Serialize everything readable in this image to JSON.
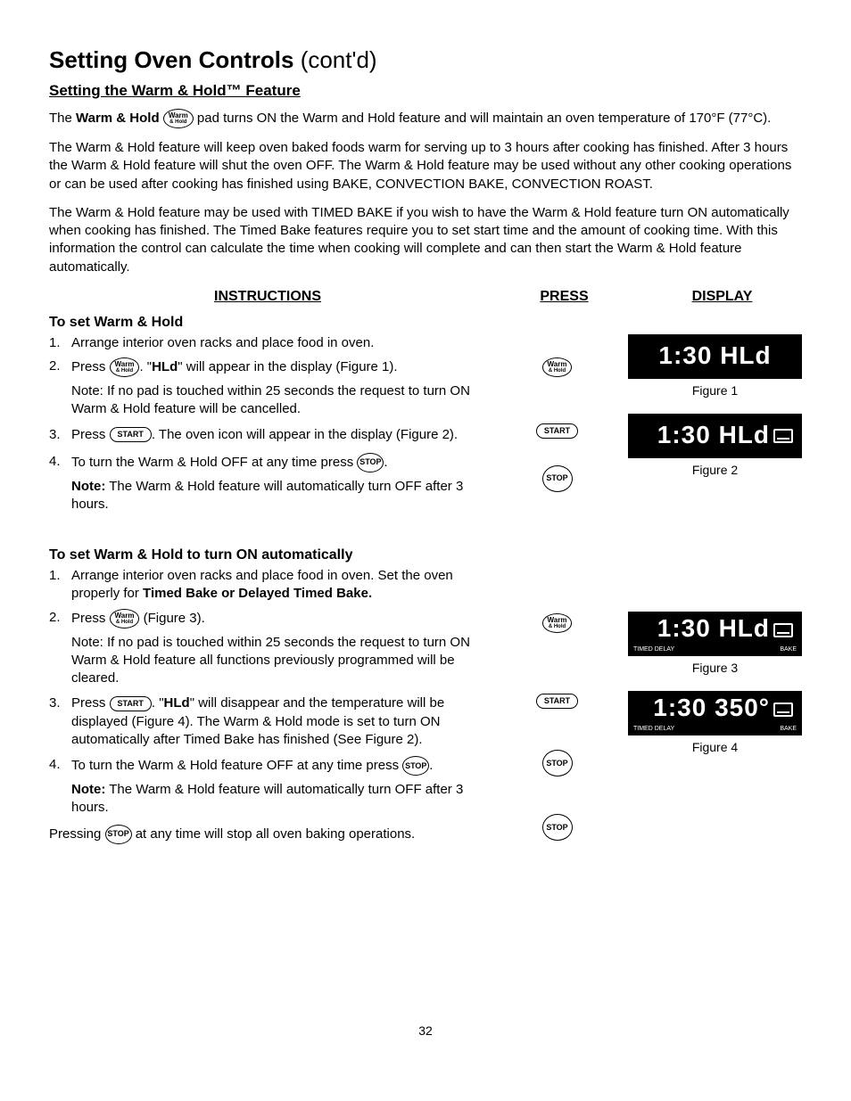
{
  "title_main": "Setting Oven Controls ",
  "title_contd": "(cont'd)",
  "subtitle": "Setting the Warm & Hold™ Feature",
  "intro1_a": "The ",
  "intro1_b": "Warm & Hold",
  "intro1_c": " pad turns ON the Warm and Hold feature and will maintain an oven temperature of 170°F (77°C).",
  "intro2": "The Warm & Hold feature will keep oven baked foods warm for serving up to 3 hours after cooking has finished. After 3 hours the Warm & Hold feature will shut the oven OFF. The Warm & Hold feature may be used without any other cooking operations or can be used after cooking has finished using BAKE, CONVECTION BAKE, CONVECTION ROAST.",
  "intro3": "The Warm & Hold feature may be used with TIMED BAKE if you wish to have the Warm & Hold feature turn ON automatically when cooking has finished. The Timed Bake features require you to set start time and the amount of cooking time. With this information the control can calculate the time when cooking will complete and can then start the Warm & Hold feature automatically.",
  "hdr_instructions": "INSTRUCTIONS",
  "hdr_press": "PRESS",
  "hdr_display": "DISPLAY",
  "sec1_title": "To set Warm & Hold",
  "s1_1": "Arrange interior oven racks and place food in oven.",
  "s1_2a": "Press ",
  "s1_2b": ". \"",
  "s1_2_hld": "HLd",
  "s1_2c": "\" will appear in the display (Figure 1).",
  "s1_2_note": "Note: If no pad is touched within 25 seconds the request to turn ON Warm & Hold feature will be cancelled.",
  "s1_3a": "Press ",
  "s1_3b": ". The oven icon will appear in the display (Figure 2).",
  "s1_4a": "To turn the Warm & Hold OFF at any time press ",
  "s1_4b": ".",
  "s1_4_note_b": "Note:",
  "s1_4_note": " The Warm & Hold feature will automatically turn OFF after 3 hours.",
  "sec2_title": "To set Warm & Hold to turn ON automatically",
  "s2_1a": "Arrange interior oven racks and place food in oven. Set the oven properly for ",
  "s2_1b": "Timed Bake or Delayed Timed Bake.",
  "s2_2a": "Press ",
  "s2_2b": " (Figure 3).",
  "s2_2_note": "Note: If no pad is touched within 25 seconds the request to turn ON Warm & Hold feature all functions previously programmed will be cleared.",
  "s2_3a": "Press ",
  "s2_3b": ". \"",
  "s2_3_hld": "HLd",
  "s2_3c": "\" will disappear and the temperature will be displayed (Figure 4). The Warm & Hold mode is set to turn ON automatically after Timed Bake has finished (See Figure 2).",
  "s2_4a": "To turn the Warm & Hold feature OFF at any time press ",
  "s2_4b": ".",
  "s2_4_note_b": "Note:",
  "s2_4_note": " The Warm & Hold feature will automatically turn OFF after 3 hours.",
  "s2_press_a": "Pressing ",
  "s2_press_b": " at any time will stop all oven baking operations.",
  "btn_warm_top": "Warm",
  "btn_warm_sub": "& Hold",
  "btn_start": "START",
  "btn_stop": "STOP",
  "disp1": "1:30 HLd",
  "disp2_main": "1:30 HLd",
  "disp3_main": "1:30 HLd",
  "disp4_main": "1:30 350°",
  "disp_timed_delay": "TIMED DELAY",
  "disp_bake": "BAKE",
  "fig1": "Figure 1",
  "fig2": "Figure 2",
  "fig3": "Figure 3",
  "fig4": "Figure 4",
  "page_num": "32"
}
